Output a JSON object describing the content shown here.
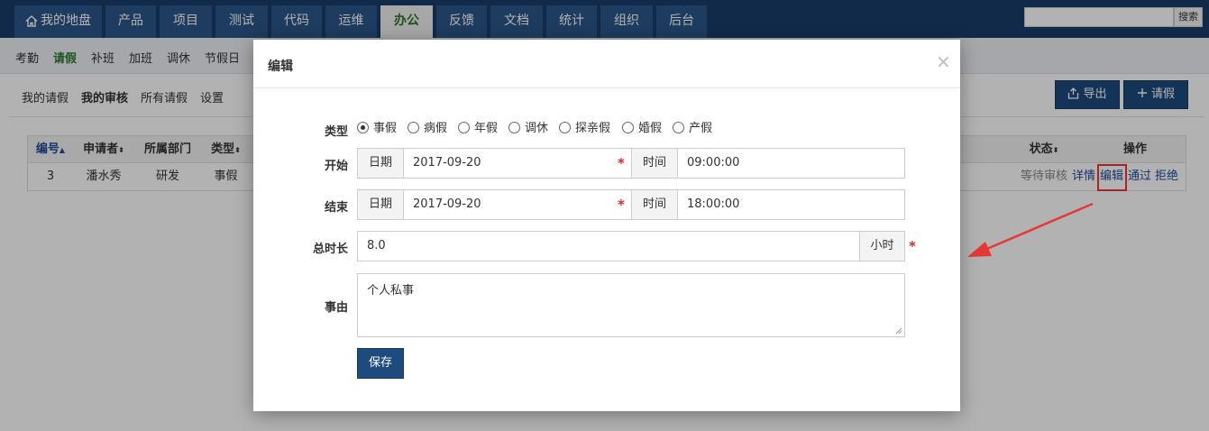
{
  "topnav": {
    "items": [
      "我的地盘",
      "产品",
      "项目",
      "测试",
      "代码",
      "运维",
      "办公",
      "反馈",
      "文档",
      "统计",
      "组织",
      "后台"
    ],
    "active_index": 6,
    "search_button": "搜索"
  },
  "subnav": {
    "items": [
      "考勤",
      "请假",
      "补班",
      "加班",
      "调休",
      "节假日"
    ],
    "active_index": 1
  },
  "content": {
    "tabs": [
      "我的请假",
      "我的审核",
      "所有请假",
      "设置"
    ],
    "active_tab_index": 1,
    "export_button": "导出",
    "add_button": "请假"
  },
  "table": {
    "headers": {
      "id": "编号",
      "applicant": "申请者",
      "department": "所属部门",
      "type": "类型",
      "status": "状态",
      "actions": "操作"
    },
    "rows": [
      {
        "id": "3",
        "applicant": "潘水秀",
        "department": "研发",
        "type": "事假",
        "status": "等待审核",
        "actions": [
          "详情",
          "编辑",
          "通过",
          "拒绝"
        ]
      }
    ]
  },
  "modal": {
    "title": "编辑",
    "close": "×",
    "type_label": "类型",
    "type_options": [
      "事假",
      "病假",
      "年假",
      "调休",
      "探亲假",
      "婚假",
      "产假"
    ],
    "type_selected_index": 0,
    "start_label": "开始",
    "start_date_label": "日期",
    "start_date": "2017-09-20",
    "start_time_label": "时间",
    "start_time": "09:00:00",
    "end_label": "结束",
    "end_date_label": "日期",
    "end_date": "2017-09-20",
    "end_time_label": "时间",
    "end_time": "18:00:00",
    "duration_label": "总时长",
    "duration": "8.0",
    "duration_unit": "小时",
    "reason_label": "事由",
    "reason": "个人私事",
    "save_button": "保存",
    "required_mark": "*"
  },
  "colors": {
    "nav_bg": "#1a3d6a",
    "primary_button": "#1e4b7d",
    "active_green": "#2c7a2c",
    "link_blue": "#1e4b9a",
    "required_red": "#d32f2f",
    "highlight_red": "#e53935"
  },
  "icons": {
    "home": "home-icon",
    "export": "export-icon",
    "add": "plus-icon",
    "sort": "sort-icon",
    "close": "close-icon"
  }
}
